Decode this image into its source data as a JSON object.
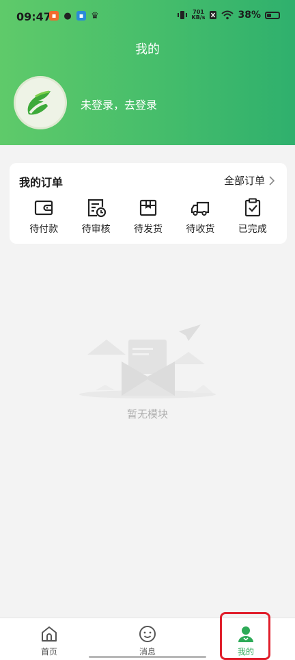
{
  "status_bar": {
    "time": "09:47",
    "net_speed_value": "701",
    "net_speed_unit": "KB/s",
    "battery": "38%"
  },
  "header": {
    "title": "我的",
    "login_text": "未登录，去登录"
  },
  "orders": {
    "title": "我的订单",
    "all_label": "全部订单",
    "items": [
      {
        "label": "待付款",
        "icon": "wallet-icon"
      },
      {
        "label": "待审核",
        "icon": "review-clock-icon"
      },
      {
        "label": "待发货",
        "icon": "package-box-icon"
      },
      {
        "label": "待收货",
        "icon": "truck-icon"
      },
      {
        "label": "已完成",
        "icon": "clipboard-check-icon"
      }
    ]
  },
  "empty_state": {
    "text": "暂无模块"
  },
  "tabbar": {
    "tabs": [
      {
        "label": "首页",
        "icon": "home-icon"
      },
      {
        "label": "消息",
        "icon": "smile-icon"
      },
      {
        "label": "我的",
        "icon": "user-icon"
      }
    ]
  },
  "colors": {
    "primary": "#45bd6b",
    "active_tab": "#2daa57",
    "highlight_box": "#e01e2b",
    "background": "#f3f3f3"
  }
}
